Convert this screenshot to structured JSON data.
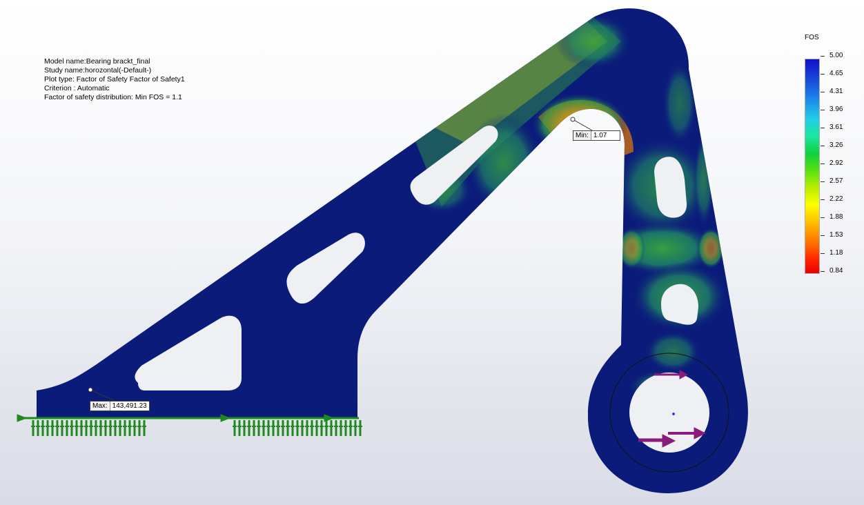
{
  "study_info": {
    "model_name": "Model name:Bearing brackt_final",
    "study_name": "Study name:horozontal(-Default-)",
    "plot_type": "Plot type: Factor of Safety Factor of Safety1",
    "criterion": "Criterion : Automatic",
    "distribution": "Factor of safety distribution: Min FOS = 1.1"
  },
  "legend": {
    "title": "FOS",
    "labels": [
      "5.00",
      "4.65",
      "4.31",
      "3.96",
      "3.61",
      "3.26",
      "2.92",
      "2.57",
      "2.22",
      "1.88",
      "1.53",
      "1.18",
      "0.84"
    ],
    "max_value": 5.0,
    "min_value": 0.84
  },
  "probes": {
    "min": {
      "name": "Min:",
      "value": "1.07"
    },
    "max": {
      "name": "Max:",
      "value": "143,491.23"
    }
  },
  "colors": {
    "part_blue": "#0b1b7a",
    "fixture_green": "#1e8a1e",
    "load_magenta": "#8a1a7c"
  }
}
